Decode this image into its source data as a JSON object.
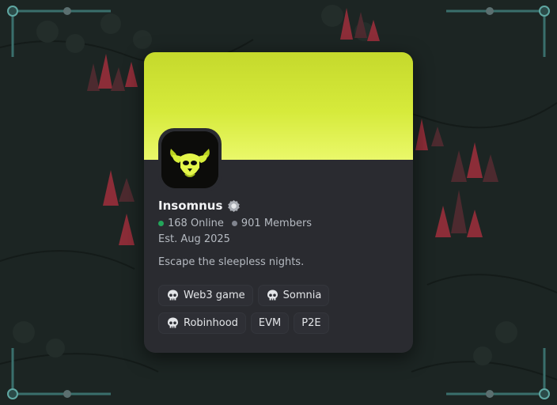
{
  "server": {
    "name": "Insomnus",
    "online_count": "168 Online",
    "member_count": "901 Members",
    "established": "Est. Aug 2025",
    "description": "Escape the sleepless nights.",
    "banner_color": "#d6ea3b",
    "online_color": "#23a55a"
  },
  "tags": [
    {
      "label": "Web3 game",
      "icon": "skull-icon"
    },
    {
      "label": "Somnia",
      "icon": "skull-icon"
    },
    {
      "label": "Robinhood",
      "icon": "skull-icon"
    },
    {
      "label": "EVM"
    },
    {
      "label": "P2E"
    }
  ]
}
